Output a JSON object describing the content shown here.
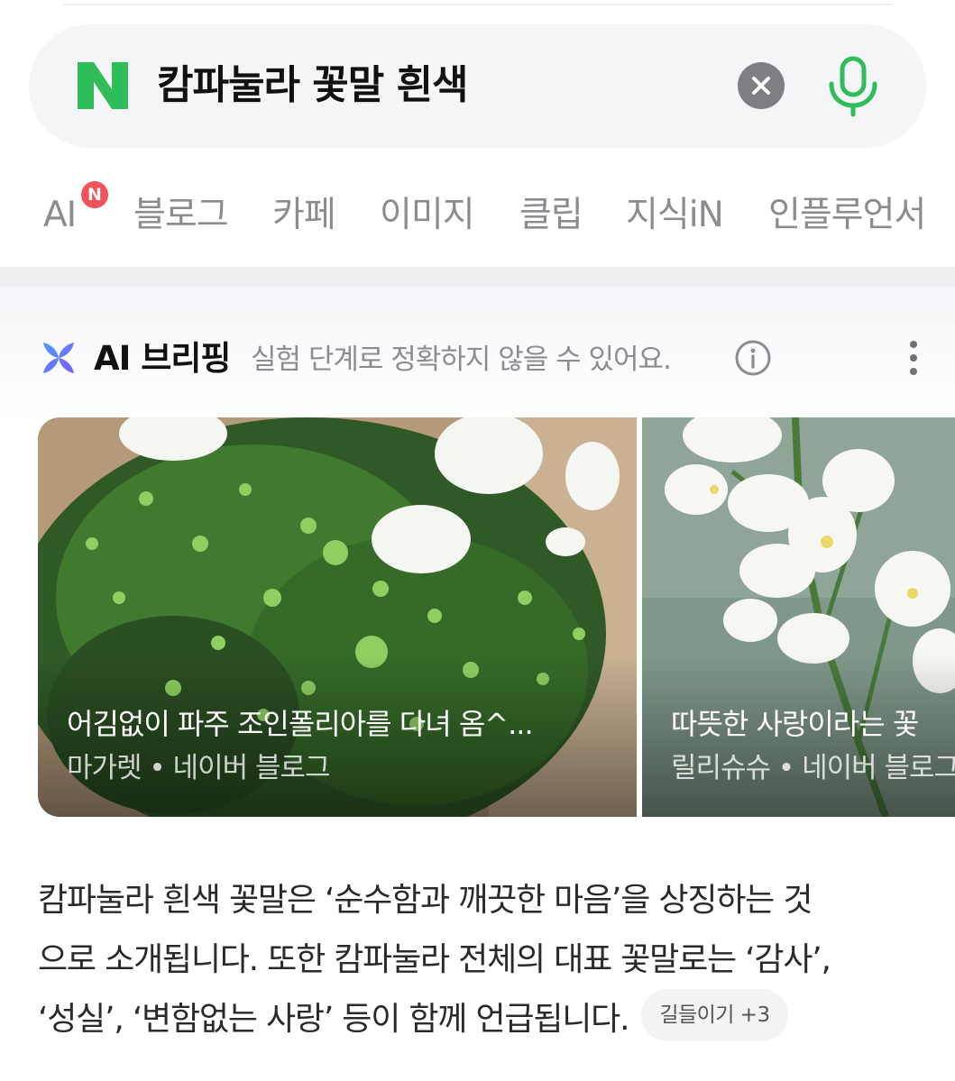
{
  "search": {
    "logo": "N",
    "query": "캄파눌라 꽃말 흰색",
    "clear_icon": "close-icon",
    "mic_icon": "microphone-icon"
  },
  "tabs": [
    {
      "label": "AI",
      "badge": "N"
    },
    {
      "label": "블로그"
    },
    {
      "label": "카페"
    },
    {
      "label": "이미지"
    },
    {
      "label": "클립"
    },
    {
      "label": "지식iN"
    },
    {
      "label": "인플루언서"
    }
  ],
  "briefing": {
    "title": "AI 브리핑",
    "note": "실험 단계로 정확하지 않을 수 있어요.",
    "cards": [
      {
        "title": "어김없이 파주 조인폴리아를 다녀 옴^...",
        "source": "마가렛 • 네이버 블로그"
      },
      {
        "title": "따뜻한 사랑이라는 꽃",
        "source": "릴리슈슈 • 네이버 블로그"
      }
    ],
    "summary_lines": [
      "캄파눌라 흰색 꽃말은 ‘순수함과 깨끗한 마음’을 상징하는 것",
      "으로 소개됩니다. 또한 캄파눌라 전체의 대표 꽃말로는 ‘감사’,",
      "‘성실’, ‘변함없는 사랑’ 등이 함께 언급됩니다."
    ],
    "chip": "길들이기 +3"
  },
  "colors": {
    "naver_green": "#2ebd59",
    "badge_red": "#f2525a"
  }
}
